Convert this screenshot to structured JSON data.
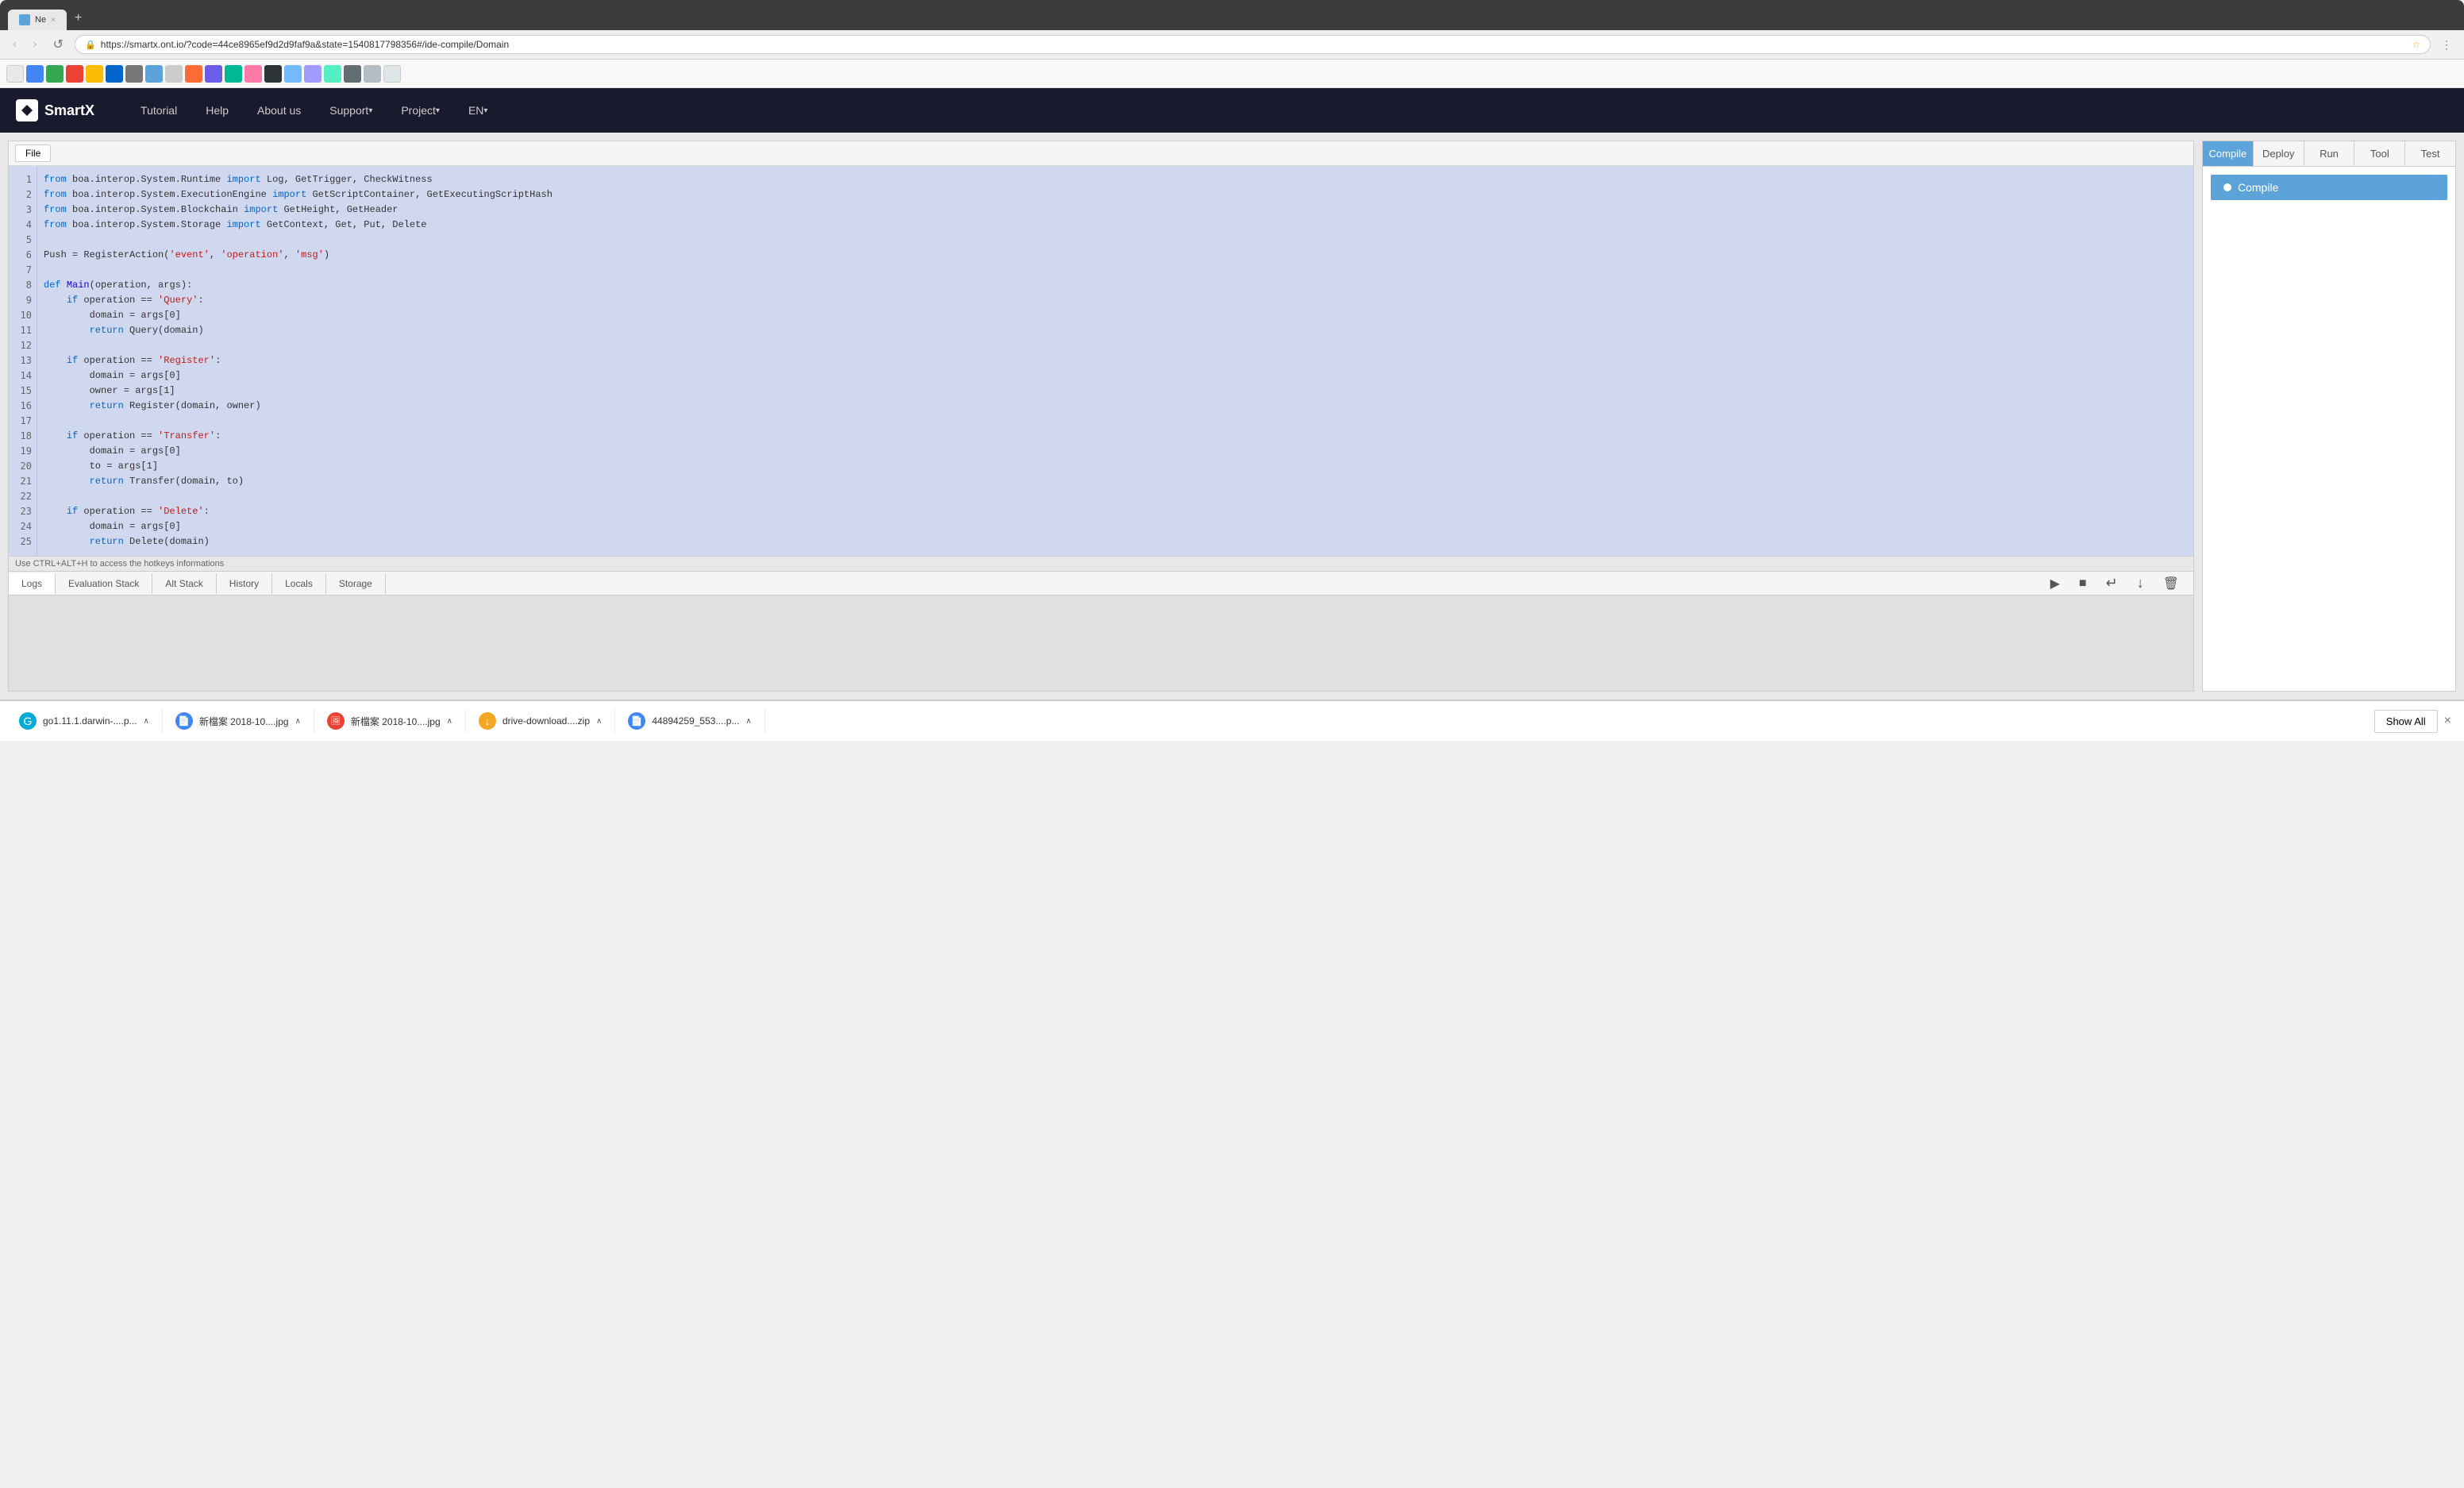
{
  "browser": {
    "url": "https://smartx.ont.io/?code=44ce8965ef9d2d9faf9a&state=1540817798356#/ide-compile/Domain",
    "tab_title": "Ne",
    "new_tab_label": "+"
  },
  "nav": {
    "logo_text": "SmartX",
    "links": [
      {
        "label": "Tutorial",
        "has_arrow": false
      },
      {
        "label": "Help",
        "has_arrow": false
      },
      {
        "label": "About us",
        "has_arrow": false
      },
      {
        "label": "Support",
        "has_arrow": true
      },
      {
        "label": "Project",
        "has_arrow": true
      },
      {
        "label": "EN",
        "has_arrow": true
      }
    ]
  },
  "editor": {
    "file_button": "File",
    "hint": "Use CTRL+ALT+H to access the hotkeys informations",
    "lines": [
      {
        "num": 1,
        "code": "from boa.interop.System.Runtime import Log, GetTrigger, CheckWitness"
      },
      {
        "num": 2,
        "code": "from boa.interop.System.ExecutionEngine import GetScriptContainer, GetExecutingScriptHash"
      },
      {
        "num": 3,
        "code": "from boa.interop.System.Blockchain import GetHeight, GetHeader"
      },
      {
        "num": 4,
        "code": "from boa.interop.System.Storage import GetContext, Get, Put, Delete"
      },
      {
        "num": 5,
        "code": ""
      },
      {
        "num": 6,
        "code": "Push = RegisterAction('event', 'operation', 'msg')"
      },
      {
        "num": 7,
        "code": ""
      },
      {
        "num": 8,
        "code": "def Main(operation, args):"
      },
      {
        "num": 9,
        "code": "    if operation == 'Query':"
      },
      {
        "num": 10,
        "code": "        domain = args[0]"
      },
      {
        "num": 11,
        "code": "        return Query(domain)"
      },
      {
        "num": 12,
        "code": ""
      },
      {
        "num": 13,
        "code": "    if operation == 'Register':"
      },
      {
        "num": 14,
        "code": "        domain = args[0]"
      },
      {
        "num": 15,
        "code": "        owner = args[1]"
      },
      {
        "num": 16,
        "code": "        return Register(domain, owner)"
      },
      {
        "num": 17,
        "code": ""
      },
      {
        "num": 18,
        "code": "    if operation == 'Transfer':"
      },
      {
        "num": 19,
        "code": "        domain = args[0]"
      },
      {
        "num": 20,
        "code": "        to = args[1]"
      },
      {
        "num": 21,
        "code": "        return Transfer(domain, to)"
      },
      {
        "num": 22,
        "code": ""
      },
      {
        "num": 23,
        "code": "    if operation == 'Delete':"
      },
      {
        "num": 24,
        "code": "        domain = args[0]"
      },
      {
        "num": 25,
        "code": "        return Delete(domain)"
      }
    ]
  },
  "bottom_tabs": [
    {
      "label": "Logs",
      "active": true
    },
    {
      "label": "Evaluation Stack",
      "active": false
    },
    {
      "label": "Alt Stack",
      "active": false
    },
    {
      "label": "History",
      "active": false
    },
    {
      "label": "Locals",
      "active": false
    },
    {
      "label": "Storage",
      "active": false
    }
  ],
  "controls": {
    "play": "▶",
    "stop": "■",
    "step_into": "↵",
    "step_over": "↓",
    "clear": "🗑"
  },
  "right_panel": {
    "tabs": [
      {
        "label": "Compile",
        "active": true
      },
      {
        "label": "Deploy",
        "active": false
      },
      {
        "label": "Run",
        "active": false
      },
      {
        "label": "Tool",
        "active": false
      },
      {
        "label": "Test",
        "active": false
      }
    ],
    "compile_button": "Compile"
  },
  "downloads": {
    "items": [
      {
        "icon_type": "go",
        "icon_text": "G",
        "name": "go1.11.1.darwin-....p...",
        "arrow": "∧"
      },
      {
        "icon_type": "doc",
        "icon_text": "📄",
        "name": "新檔案 2018-10....jpg",
        "arrow": "∧"
      },
      {
        "icon_type": "img",
        "icon_text": "🖼",
        "name": "新檔案 2018-10....jpg",
        "arrow": "∧"
      },
      {
        "icon_type": "zip",
        "icon_text": "↓",
        "name": "drive-download....zip",
        "arrow": "∧"
      },
      {
        "icon_type": "doc",
        "icon_text": "📄",
        "name": "44894259_553....p...",
        "arrow": "∧"
      }
    ],
    "show_all": "Show All",
    "close": "×"
  }
}
